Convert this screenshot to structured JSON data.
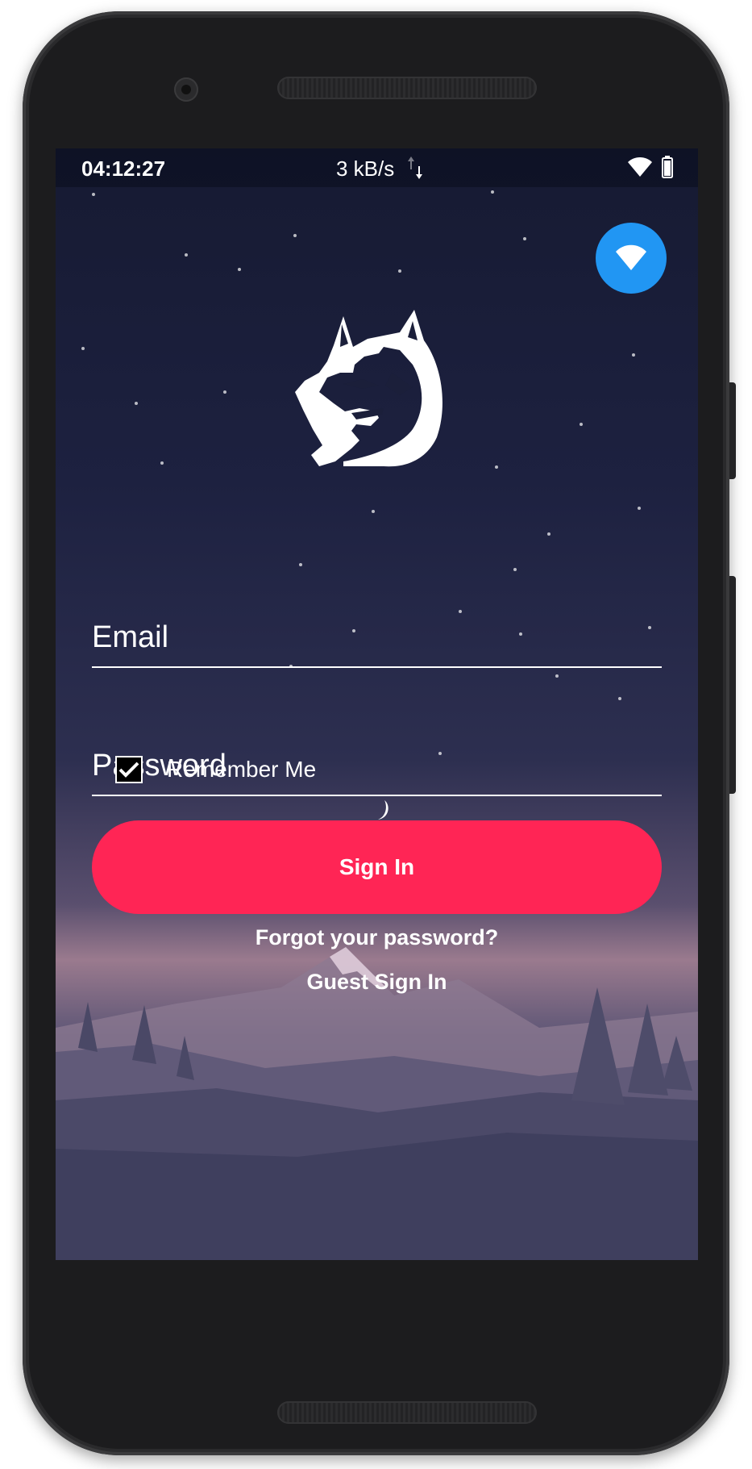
{
  "status_bar": {
    "time": "04:12:27",
    "network_speed": "3 kB/s",
    "icons": [
      "data-transfer-icon",
      "wifi-icon",
      "battery-icon"
    ]
  },
  "wifi_button": {
    "icon": "wifi-icon",
    "color": "#2196f3"
  },
  "logo": {
    "icon": "husky-logo-icon"
  },
  "form": {
    "email_placeholder": "Email",
    "email_value": "",
    "password_placeholder": "Password",
    "password_value": "",
    "remember_me_label": "Remember Me",
    "remember_me_checked": true,
    "sign_in_label": "Sign In",
    "sign_in_color": "#ff2555"
  },
  "links": {
    "forgot_password": "Forgot your password?",
    "guest_sign_in": "Guest Sign In"
  }
}
